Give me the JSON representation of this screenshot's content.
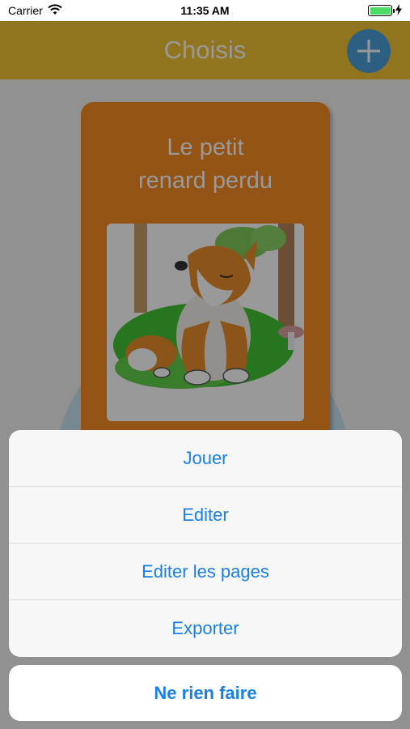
{
  "status_bar": {
    "carrier": "Carrier",
    "time": "11:35 AM",
    "battery_percent": 100
  },
  "header": {
    "title": "Choisis",
    "add_icon": "plus-icon"
  },
  "story_card": {
    "title": "Le petit renard perdu",
    "image_icon": "fox-illustration"
  },
  "action_sheet": {
    "items": [
      {
        "label": "Jouer"
      },
      {
        "label": "Editer"
      },
      {
        "label": "Editer les pages"
      },
      {
        "label": "Exporter"
      }
    ],
    "cancel_label": "Ne rien faire"
  },
  "colors": {
    "header": "#f2c232",
    "add_button": "#4a9fd8",
    "card": "#f58a22",
    "action_text": "#1a7fe8"
  }
}
